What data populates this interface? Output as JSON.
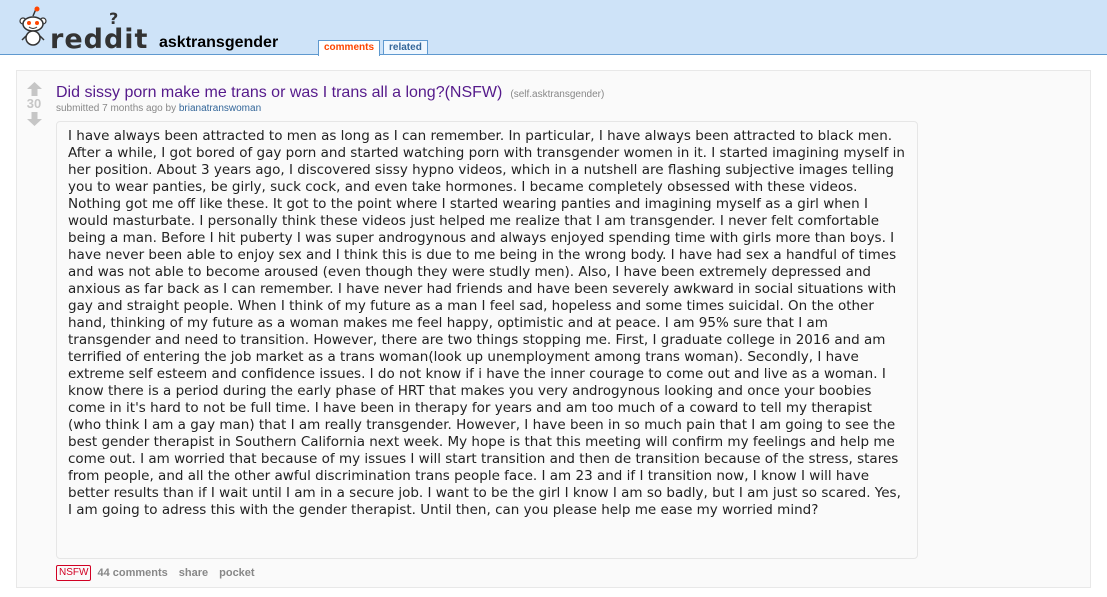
{
  "header": {
    "logo_text": "reddit",
    "logo_mark": "?",
    "subreddit": "asktransgender",
    "tabs": [
      {
        "label": "comments",
        "active": true
      },
      {
        "label": "related",
        "active": false
      }
    ],
    "colors": {
      "background": "#cee3f8",
      "border": "#5f99cf",
      "active_tab": "#ff4500"
    }
  },
  "post": {
    "score": "30",
    "upvote_icon": "upvote-arrow-icon",
    "downvote_icon": "downvote-arrow-icon",
    "title": "Did sissy porn make me trans or was I trans all a long?(NSFW)",
    "domain": "(self.asktransgender)",
    "submitted_prefix": "submitted 7 months ago by",
    "author": "brianatranswoman",
    "body": "I have always been attracted to men as long as I can remember. In particular, I have always been attracted to black men. After a while, I got bored of gay porn and started watching porn with transgender women in it. I started imagining myself in her position. About 3 years ago, I discovered sissy hypno videos, which in a nutshell are flashing subjective images telling you to wear panties, be girly, suck cock, and even take hormones. I became completely obsessed with these videos. Nothing got me off like these. It got to the point where I started wearing panties and imagining myself as a girl when I would masturbate. I personally think these videos just helped me realize that I am transgender. I never felt comfortable being a man. Before I hit puberty I was super androgynous and always enjoyed spending time with girls more than boys. I have never been able to enjoy sex and I think this is due to me being in the wrong body. I have had sex a handful of times and was not able to become aroused (even though they were studly men). Also, I have been extremely depressed and anxious as far back as I can remember. I have never had friends and have been severely awkward in social situations with gay and straight people. When I think of my future as a man I feel sad, hopeless and some times suicidal. On the other hand, thinking of my future as a woman makes me feel happy, optimistic and at peace. I am 95% sure that I am transgender and need to transition. However, there are two things stopping me. First, I graduate college in 2016 and am terrified of entering the job market as a trans woman(look up unemployment among trans woman). Secondly, I have extreme self esteem and confidence issues. I do not know if i have the inner courage to come out and live as a woman. I know there is a period during the early phase of HRT that makes you very androgynous looking and once your boobies come in it's hard to not be full time. I have been in therapy for years and am too much of a coward to tell my therapist (who think I am a gay man) that I am really transgender. However, I have been in so much pain that I am going to see the best gender therapist in Southern California next week. My hope is that this meeting will confirm my feelings and help me come out. I am worried that because of my issues I will start transition and then de transition because of the stress, stares from people, and all the other awful discrimination trans people face. I am 23 and if I transition now, I know I will have better results than if I wait until I am in a secure job. I want to be the girl I know I am so badly, but I am just so scared. Yes, I am going to adress this with the gender therapist. Until then, can you please help me ease my worried mind?",
    "nsfw_label": "NSFW",
    "comments_label": "44 comments",
    "share_label": "share",
    "pocket_label": "pocket",
    "colors": {
      "title": "#551a8b",
      "nsfw": "#d10023",
      "author": "#336699"
    }
  }
}
